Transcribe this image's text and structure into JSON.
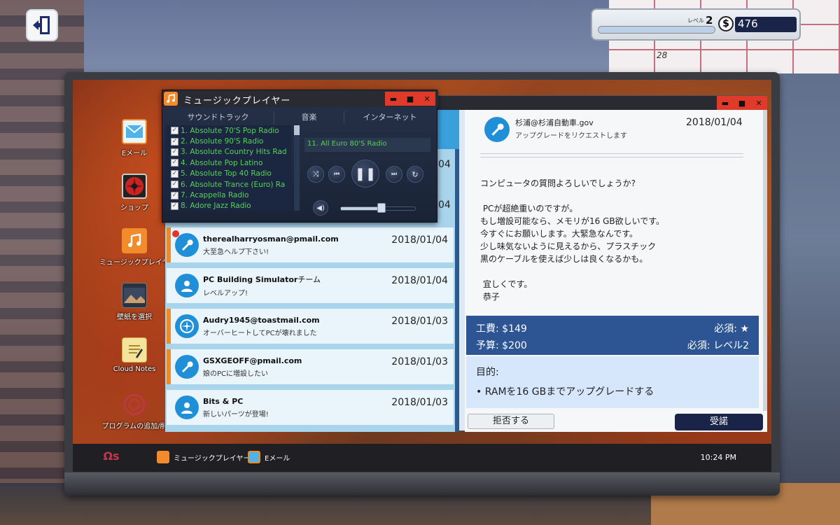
{
  "hud": {
    "level_label": "レベル",
    "level": "2",
    "level_progress_pct": 100,
    "currency_symbol": "$",
    "money": "476"
  },
  "calendar": {
    "visible_date": "28"
  },
  "desktop_icons": [
    {
      "id": "email",
      "label": "Eメール",
      "icon": "email-icon"
    },
    {
      "id": "shop",
      "label": "ショップ",
      "icon": "fan-icon"
    },
    {
      "id": "music",
      "label": "ミュージックプレイヤー",
      "icon": "music-note-icon"
    },
    {
      "id": "wallpaper",
      "label": "壁紙を選択",
      "icon": "wallpaper-icon"
    },
    {
      "id": "notes",
      "label": "Cloud Notes",
      "icon": "notepad-icon"
    },
    {
      "id": "programs",
      "label": "プログラムの追加/削",
      "icon": "programs-icon"
    }
  ],
  "music": {
    "title": "ミュージックプレイヤー",
    "tabs": [
      "サウンドトラック",
      "音楽",
      "インターネット"
    ],
    "stations": [
      "1. Absolute 70'S Pop Radio",
      "2. Absolute 90'S Radio",
      "3. Absolute Country Hits Rad",
      "4. Absolute Pop Latino",
      "5. Absolute Top 40 Radio",
      "6. Absolute Trance (Euro) Ra",
      "7. Acappella Radio",
      "8. Adore Jazz Radio"
    ],
    "now_playing": "11. All Euro 80'S Radio",
    "volume_pct": 55
  },
  "email": {
    "list_partial_dates": [
      "04",
      "04"
    ],
    "list": [
      {
        "from": "therealharryosman@pmail.com",
        "from_suffix": "",
        "subject": "大至急ヘルプ下さい!",
        "date": "2018/01/04",
        "avatar": "wrench-icon",
        "flag": true,
        "unread": true
      },
      {
        "from": "PC Building Simulator",
        "from_suffix": "チーム",
        "subject": "レベルアップ!",
        "date": "2018/01/04",
        "avatar": "person-icon",
        "flag": false,
        "unread": false
      },
      {
        "from": "Audry1945@toastmail.com",
        "from_suffix": "",
        "subject": "オーバーヒートしてPCが壊れました",
        "date": "2018/01/03",
        "avatar": "fan-icon",
        "flag": true,
        "unread": false
      },
      {
        "from": "GSXGEOFF@pmail.com",
        "from_suffix": "",
        "subject": "娘のPCに増設したい",
        "date": "2018/01/03",
        "avatar": "wrench-icon",
        "flag": true,
        "unread": false
      },
      {
        "from": "Bits & PC",
        "from_suffix": "",
        "subject": "新しいパーツが登場!",
        "date": "2018/01/03",
        "avatar": "person-icon",
        "flag": false,
        "unread": false
      }
    ],
    "reader": {
      "from": "杉浦@杉浦自動車.gov",
      "subject": "アップグレードをリクエストします",
      "date": "2018/01/04",
      "body": [
        "コンピュータの質問よろしいでしょうか?",
        "",
        " PCが超絶重いのですが。",
        "もし増設可能なら、メモリが16 GB欲しいです。",
        "今すぐにお願いします。大緊急なんです。",
        "少し味気ないように見えるから、プラスチック",
        "黒のケーブルを使えば少しは良くなるかも。",
        "",
        " 宜しくです。",
        " 恭子"
      ],
      "fee_label": "工費:",
      "fee": "$149",
      "budget_label": "予算:",
      "budget": "$200",
      "req1_label": "必須:",
      "req1": "★",
      "req2_label": "必須:",
      "req2": "レベル2",
      "goal_title": "目的:",
      "goal_items": [
        "• RAMを16 GBまでアップグレードする"
      ],
      "decline": "拒否する",
      "accept": "受諾"
    }
  },
  "taskbar": {
    "os_label": "Ωs",
    "items": [
      {
        "label": "ミュージックプレイヤー",
        "icon": "music-note-icon"
      },
      {
        "label": "Eメール",
        "icon": "email-icon"
      }
    ],
    "time": "10:24 PM"
  },
  "colors": {
    "accent_orange": "#f08a24",
    "email_blue": "#1f8fd8",
    "window_close_red": "#e03a2a",
    "station_green": "#58d05a",
    "accept_navy": "#1a2348",
    "job_box_blue": "#2d5594"
  }
}
